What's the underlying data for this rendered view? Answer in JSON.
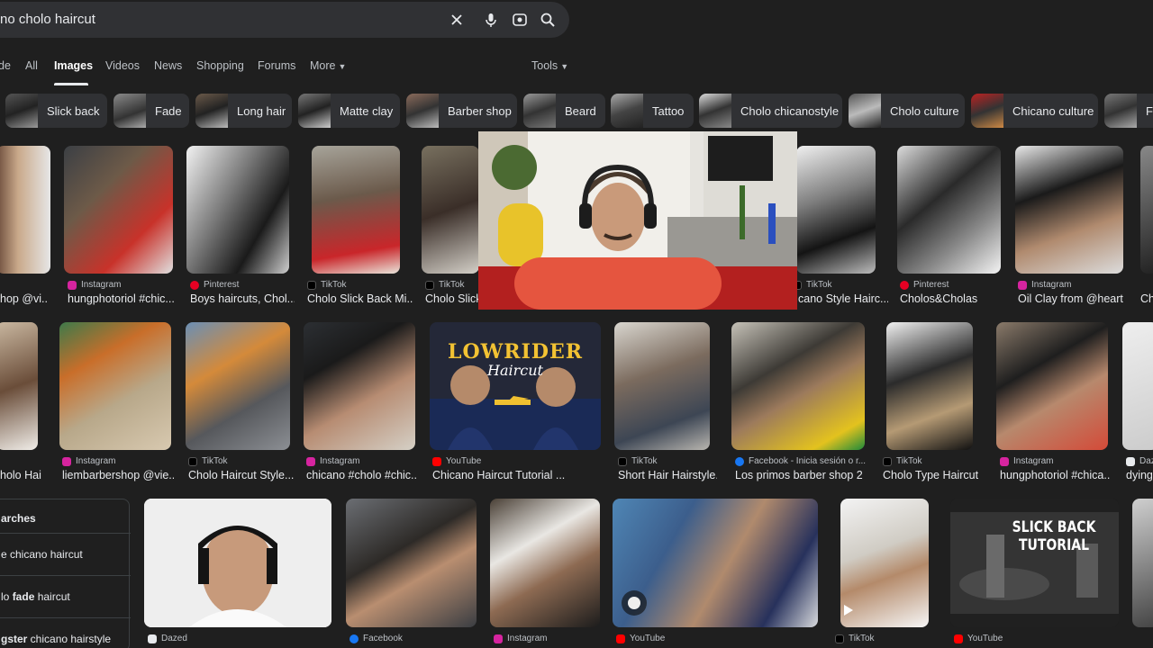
{
  "search": {
    "query": "no cholo haircut"
  },
  "tabs": [
    "de",
    "All",
    "Images",
    "Videos",
    "News",
    "Shopping",
    "Forums",
    "More"
  ],
  "tools_label": "Tools",
  "chips": [
    "Slick back",
    "Fade",
    "Long hair",
    "Matte clay",
    "Barber shop",
    "Beard",
    "Tattoo",
    "Cholo chicanostyle",
    "Cholo culture",
    "Chicano culture",
    "F"
  ],
  "row1": [
    {
      "source": "",
      "title": "hop @vi..."
    },
    {
      "source": "Instagram",
      "title": "hungphotoriol #chic..."
    },
    {
      "source": "Pinterest",
      "title": "Boys haircuts, Chol..."
    },
    {
      "source": "TikTok",
      "title": "Cholo Slick Back Mi..."
    },
    {
      "source": "TikTok",
      "title": "Cholo Slick"
    },
    {
      "source": "TikTok",
      "title": "cano Style Hairc..."
    },
    {
      "source": "Pinterest",
      "title": "Cholos&Cholas"
    },
    {
      "source": "Instagram",
      "title": "Oil Clay from @heart..."
    },
    {
      "source": "",
      "title": "Ch"
    }
  ],
  "row2": [
    {
      "source": "",
      "title": "holo Hai..."
    },
    {
      "source": "Instagram",
      "title": "liembarbershop @vie..."
    },
    {
      "source": "TikTok",
      "title": "Cholo Haircut Style..."
    },
    {
      "source": "Instagram",
      "title": "chicano #cholo #chic..."
    },
    {
      "source": "YouTube",
      "title": "Chicano Haircut Tutorial ..."
    },
    {
      "source": "TikTok",
      "title": "Short Hair Hairstyle..."
    },
    {
      "source": "Facebook - Inicia sesión o r...",
      "title": "Los primos barber shop 2 ..."
    },
    {
      "source": "TikTok",
      "title": "Cholo Type Haircut ..."
    },
    {
      "source": "Instagram",
      "title": "hungphotoriol #chica..."
    },
    {
      "source": "Daz",
      "title": "dying"
    }
  ],
  "row3_sources": [
    "Dazed",
    "Facebook",
    "Instagram",
    "YouTube",
    "TikTok",
    "YouTube"
  ],
  "thumb_texts": {
    "lowrider_line1": "LOWRIDER",
    "lowrider_line2": "Haircut",
    "slickback_line1": "SLICK BACK",
    "slickback_line2": "TUTORIAL"
  },
  "related": {
    "header": "arches",
    "items": [
      {
        "pre": "e chicano haircut",
        "bold": ""
      },
      {
        "pre": "lo ",
        "bold": "fade",
        "post": " haircut"
      },
      {
        "pre": "",
        "bold": "gster",
        "post": " chicano hairstyle"
      }
    ]
  },
  "colors": {
    "bg": "#1f1f1f",
    "surface": "#303134",
    "text": "#e8eaed",
    "muted": "#bdc1c6",
    "instagram": "#d6249f",
    "pinterest": "#e60023",
    "tiktok": "#000000",
    "youtube": "#ff0000",
    "facebook": "#1877f2"
  }
}
